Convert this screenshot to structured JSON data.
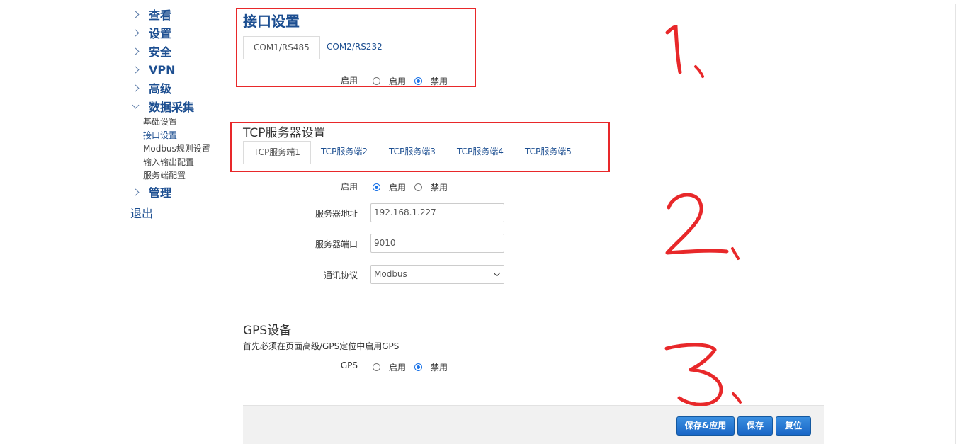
{
  "sidebar": {
    "items": [
      {
        "label": "查看"
      },
      {
        "label": "设置"
      },
      {
        "label": "安全"
      },
      {
        "label": "VPN"
      },
      {
        "label": "高级"
      },
      {
        "label": "数据采集"
      }
    ],
    "sub_items": [
      {
        "label": "基础设置"
      },
      {
        "label": "接口设置",
        "active": true
      },
      {
        "label": "Modbus规则设置"
      },
      {
        "label": "输入输出配置"
      },
      {
        "label": "服务端配置"
      }
    ],
    "manage_label": "管理",
    "logout_label": "退出"
  },
  "interface": {
    "title": "接口设置",
    "tabs": [
      {
        "label": "COM1/RS485",
        "active": true
      },
      {
        "label": "COM2/RS232"
      }
    ],
    "enable_label": "启用",
    "enable_options": [
      "启用",
      "禁用"
    ],
    "enable_selected": "禁用"
  },
  "tcp": {
    "title": "TCP服务器设置",
    "tabs": [
      {
        "label": "TCP服务端1",
        "active": true
      },
      {
        "label": "TCP服务端2"
      },
      {
        "label": "TCP服务端3"
      },
      {
        "label": "TCP服务端4"
      },
      {
        "label": "TCP服务端5"
      }
    ],
    "enable_label": "启用",
    "enable_options": [
      "启用",
      "禁用"
    ],
    "enable_selected": "启用",
    "server_address_label": "服务器地址",
    "server_address_value": "192.168.1.227",
    "server_port_label": "服务器端口",
    "server_port_value": "9010",
    "protocol_label": "通讯协议",
    "protocol_value": "Modbus"
  },
  "gps": {
    "title": "GPS设备",
    "note": "首先必须在页面高级/GPS定位中启用GPS",
    "label": "GPS",
    "options": [
      "启用",
      "禁用"
    ],
    "selected": "禁用"
  },
  "actions": {
    "save_apply": "保存&应用",
    "save": "保存",
    "reset": "复位"
  },
  "colors": {
    "accent": "#1d4f91",
    "button": "#1a67c7",
    "annotation": "#e8282a"
  }
}
